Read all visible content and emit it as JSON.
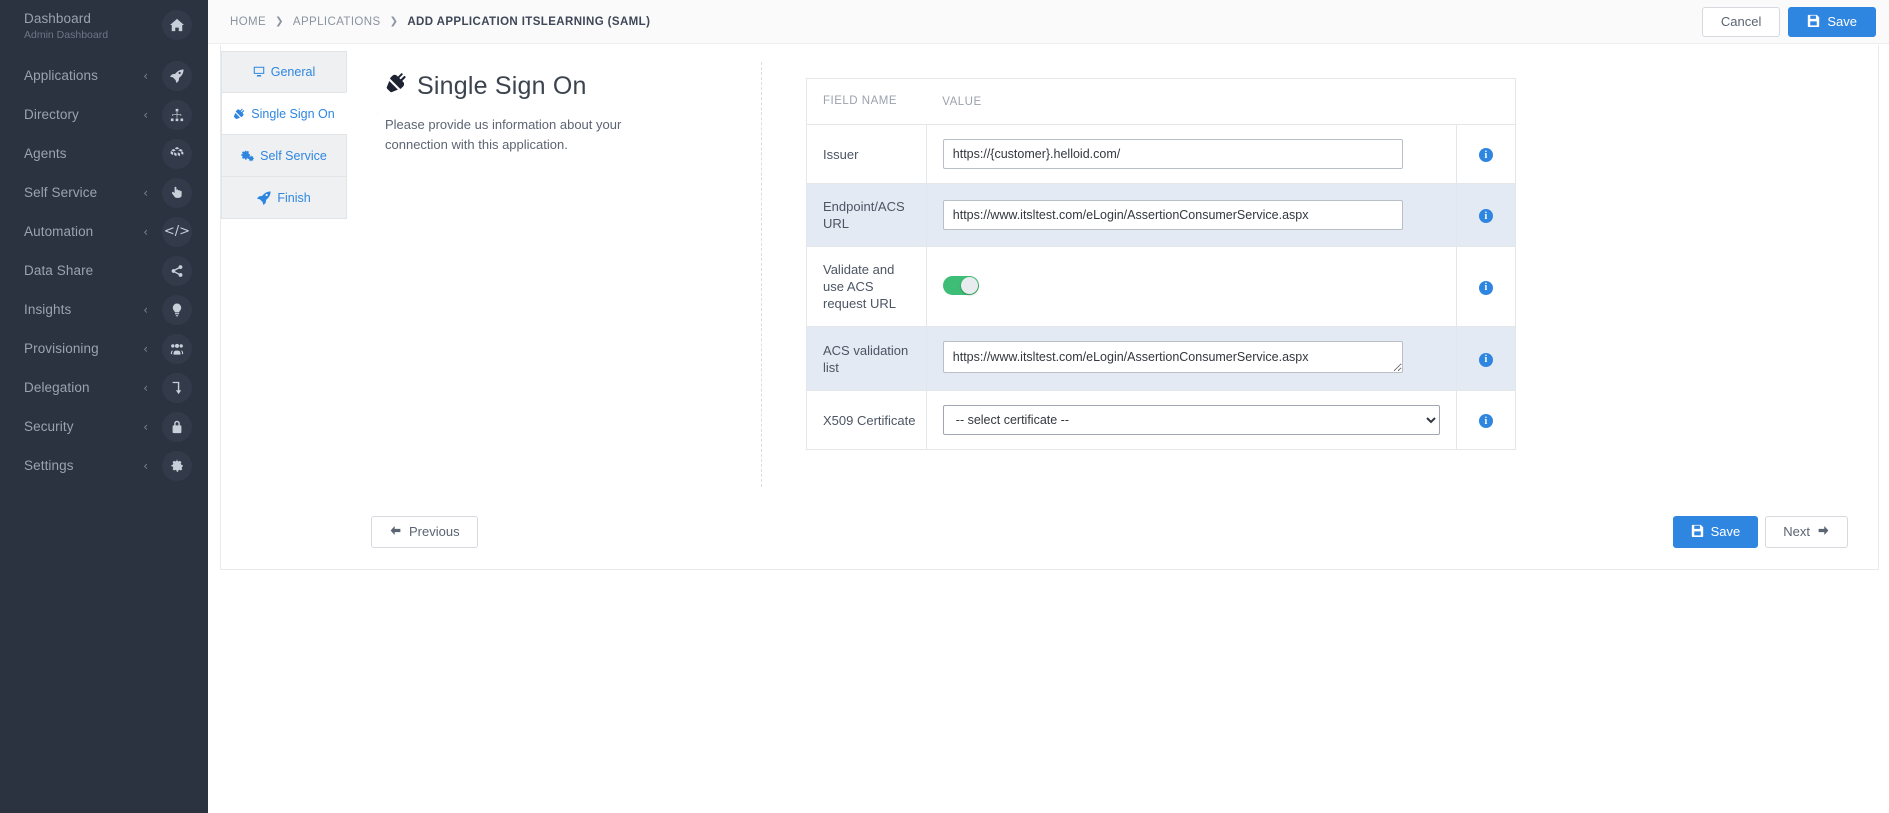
{
  "sidebar": {
    "items": [
      {
        "label": "Dashboard",
        "sub": "Admin Dashboard",
        "icon": "home-icon",
        "caret": ""
      },
      {
        "label": "Applications",
        "sub": "",
        "icon": "rocket-icon",
        "caret": "‹"
      },
      {
        "label": "Directory",
        "sub": "",
        "icon": "sitemap-icon",
        "caret": "‹"
      },
      {
        "label": "Agents",
        "sub": "",
        "icon": "cubes-icon",
        "caret": ""
      },
      {
        "label": "Self Service",
        "sub": "",
        "icon": "hand-pointer-icon",
        "caret": "‹"
      },
      {
        "label": "Automation",
        "sub": "",
        "icon": "code-icon",
        "caret": "‹"
      },
      {
        "label": "Data Share",
        "sub": "",
        "icon": "share-icon",
        "caret": ""
      },
      {
        "label": "Insights",
        "sub": "",
        "icon": "lightbulb-icon",
        "caret": "‹"
      },
      {
        "label": "Provisioning",
        "sub": "",
        "icon": "users-icon",
        "caret": "‹"
      },
      {
        "label": "Delegation",
        "sub": "",
        "icon": "level-down-icon",
        "caret": "‹"
      },
      {
        "label": "Security",
        "sub": "",
        "icon": "lock-icon",
        "caret": "‹"
      },
      {
        "label": "Settings",
        "sub": "",
        "icon": "gear-icon",
        "caret": "‹"
      }
    ]
  },
  "topbar": {
    "breadcrumb": [
      {
        "label": "HOME"
      },
      {
        "label": "APPLICATIONS"
      },
      {
        "label": "ADD APPLICATION ITSLEARNING (SAML)"
      }
    ],
    "separator": "❯",
    "cancel_label": "Cancel",
    "save_label": "Save"
  },
  "wizard": {
    "steps": [
      {
        "label": "General",
        "icon": "desktop-icon",
        "active": false
      },
      {
        "label": "Single Sign On",
        "icon": "plug-icon",
        "active": true
      },
      {
        "label": "Self Service",
        "icon": "cogs-icon",
        "active": false
      },
      {
        "label": "Finish",
        "icon": "rocket-icon",
        "active": false
      }
    ]
  },
  "intro": {
    "icon": "plug-icon",
    "title": "Single Sign On",
    "description": "Please provide us information about your connection with this application."
  },
  "table": {
    "headers": [
      "FIELD NAME",
      "VALUE",
      ""
    ],
    "rows": [
      {
        "name": "Issuer",
        "control": "text",
        "value": "https://{customer}.helloid.com/",
        "info": "i",
        "alt": false
      },
      {
        "name": "Endpoint/ACS URL",
        "control": "text",
        "value": "https://www.itsltest.com/eLogin/AssertionConsumerService.aspx",
        "info": "i",
        "alt": true
      },
      {
        "name": "Validate and use ACS request URL",
        "control": "toggle",
        "value": "on",
        "info": "i",
        "alt": false
      },
      {
        "name": "ACS validation list",
        "control": "textarea",
        "value": "https://www.itsltest.com/eLogin/AssertionConsumerService.aspx",
        "info": "i",
        "alt": true
      },
      {
        "name": "X509 Certificate",
        "control": "select",
        "value": "-- select certificate --",
        "info": "i",
        "alt": false
      }
    ]
  },
  "footer": {
    "previous_label": "Previous",
    "save_label": "Save",
    "next_label": "Next"
  },
  "colors": {
    "accent": "#2f86e0",
    "sidebar_bg": "#2b3240",
    "toggle_on": "#3dbd75",
    "row_alt": "#e4eaf3"
  }
}
